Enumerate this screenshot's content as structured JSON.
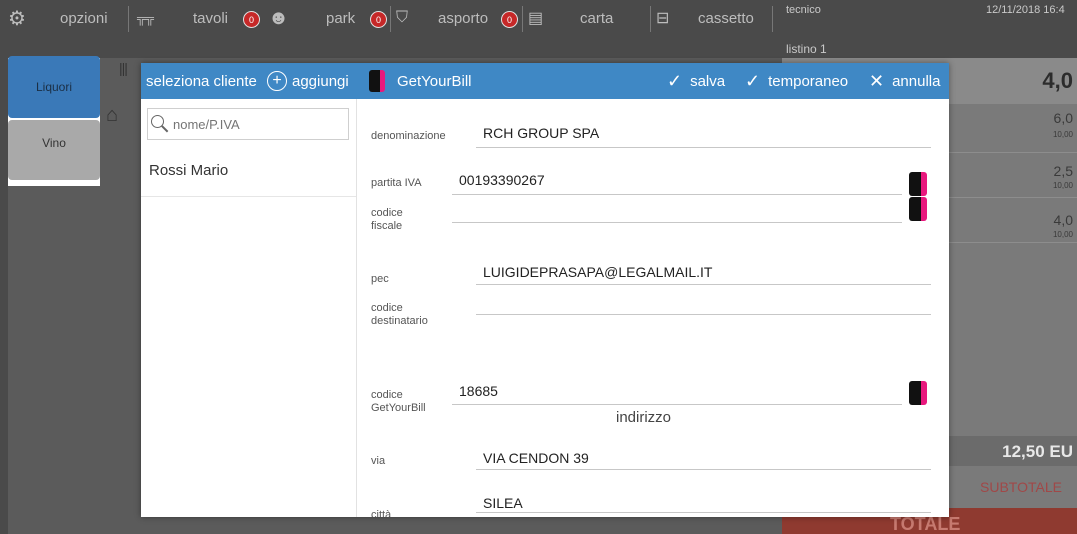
{
  "topbar": {
    "options_label": "opzioni",
    "tables_label": "tavoli",
    "tables_badge": "0",
    "park_label": "park",
    "park_badge": "0",
    "takeaway_label": "asporto",
    "takeaway_badge": "0",
    "card_label": "carta",
    "drawer_label": "cassetto",
    "operator": "tecnico",
    "price_list": "listino 1",
    "datetime": "12/11/2018 16:4"
  },
  "categories": [
    {
      "label": "Liquori"
    },
    {
      "label": "Vino"
    }
  ],
  "receipt": {
    "header_amount": "4,0",
    "rows": [
      {
        "amount": "6,0",
        "sub": "10,00"
      },
      {
        "amount": "2,5",
        "sub": "10,00"
      },
      {
        "amount": "4,0",
        "sub": "10,00"
      }
    ],
    "total_amount": "12,50 EU",
    "subtotal_label": "SUBTOTALE",
    "total_label": "TOTALE"
  },
  "dialog": {
    "title": "seleziona cliente",
    "add_label": "aggiungi",
    "gyb_label": "GetYourBill",
    "save_label": "salva",
    "temp_label": "temporaneo",
    "cancel_label": "annulla",
    "search_placeholder": "nome/P.IVA",
    "customers": [
      "Rossi Mario"
    ],
    "fields": {
      "denominazione": {
        "label": "denominazione",
        "value": "RCH GROUP SPA"
      },
      "partita_iva": {
        "label": "partita IVA",
        "value": "00193390267"
      },
      "codice_fiscale": {
        "label_1": "codice",
        "label_2": "fiscale",
        "value": ""
      },
      "pec": {
        "label": "pec",
        "value": "LUIGIDEPRASAPA@LEGALMAIL.IT"
      },
      "codice_destinatario": {
        "label_1": "codice",
        "label_2": "destinatario",
        "value": ""
      },
      "codice_gyb": {
        "label_1": "codice",
        "label_2": "GetYourBill",
        "value": "18685"
      },
      "address_header": "indirizzo",
      "via": {
        "label": "via",
        "value": "VIA CENDON 39"
      },
      "citta": {
        "label": "città",
        "value": "SILEA"
      }
    }
  },
  "colors": {
    "accent": "#3f88c5",
    "gyb_pink": "#e8187d",
    "badge_red": "#c62828",
    "total_red": "#c0392b"
  }
}
